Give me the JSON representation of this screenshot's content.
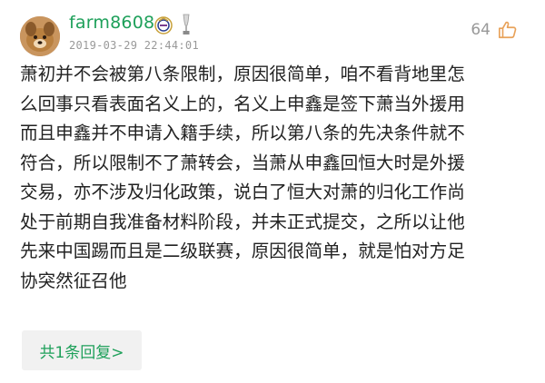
{
  "user": {
    "name": "farm8608",
    "timestamp": "2019-03-29 22:44:01"
  },
  "likes": {
    "count": "64"
  },
  "comment": {
    "lines": [
      "萧初并不会被第八条限制，原因很简单，咱不看背地里怎",
      "么回事只看表面名义上的，名义上申鑫是签下萧当外援用",
      "而且申鑫并不申请入籍手续，所以第八条的先决条件就不",
      "符合，所以限制不了萧转会，当萧从申鑫回恒大时是外援",
      "交易，亦不涉及归化政策，说白了恒大对萧的归化工作尚",
      "处于前期自我准备材料阶段，并未正式提交，之所以让他",
      "先来中国踢而且是二级联赛，原因很简单，就是怕对方足",
      "协突然征召他"
    ]
  },
  "reply": {
    "label": "共1条回复>"
  },
  "colors": {
    "accent": "#1ea05a",
    "muted": "#999999",
    "text": "#222222",
    "button_bg": "#f1f1f1"
  },
  "icons": [
    "avatar",
    "club-crest-icon",
    "trophy-icon",
    "thumbs-up-icon"
  ]
}
